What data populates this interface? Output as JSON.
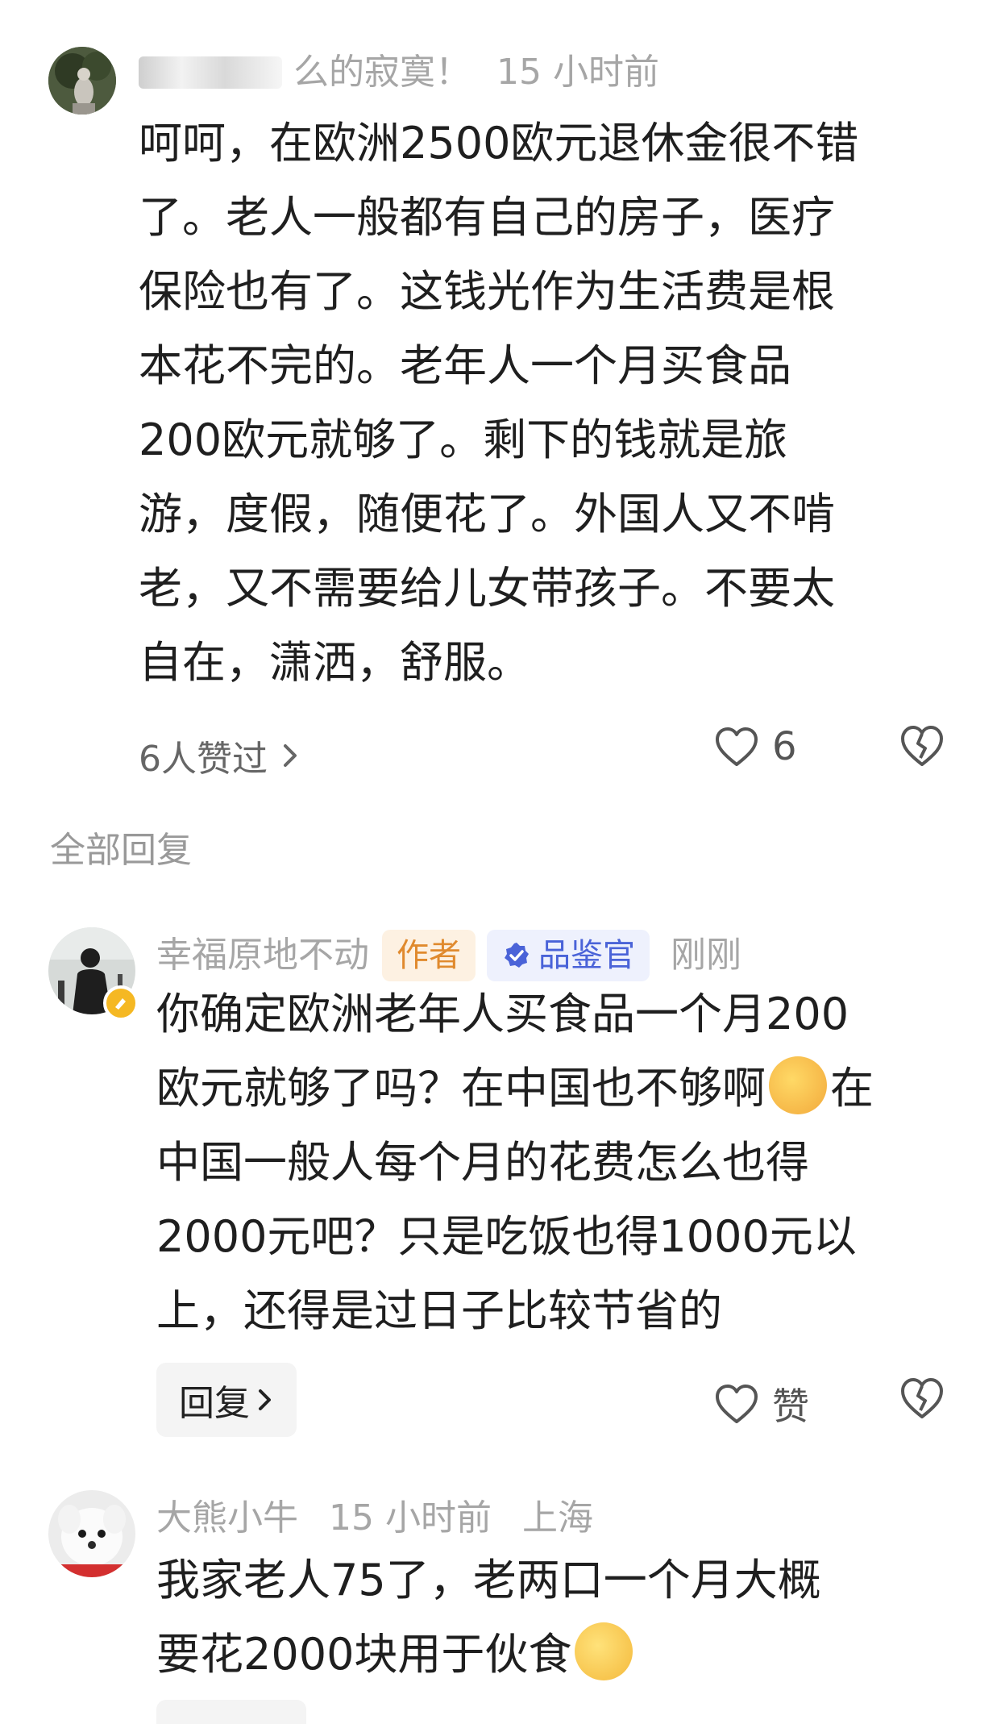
{
  "top_comment": {
    "username_partial": "么的寂寞！",
    "time": "15 小时前",
    "lines": [
      "呵呵，在欧洲2500欧元退休金很不错",
      "了。老人一般都有自己的房子，医疗",
      "保险也有了。这钱光作为生活费是根",
      "本花不完的。老年人一个月买食品",
      " 200欧元就够了。剩下的钱就是旅",
      "游，度假，随便花了。外国人又不啃",
      "老，又不需要给儿女带孩子。不要太",
      "自在，潇洒，舒服。"
    ],
    "liked_by": "6人赞过",
    "like_count": "6"
  },
  "section_label": "全部回复",
  "reply_1": {
    "username": "幸福原地不动",
    "author_tag": "作者",
    "badge_label": "品鉴官",
    "time": "刚刚",
    "lines": [
      "你确定欧洲老年人买食品一个月200",
      "欧元就够了吗？在中国也不够啊",
      "中国一般人每个月的花费怎么也得",
      " 2000元吧？只是吃饭也得1000元以",
      "上，还得是过日子比较节省的"
    ],
    "line2_tail": "在",
    "reply_button": "回复",
    "like_label": "赞"
  },
  "reply_2": {
    "username": "大熊小牛",
    "time": "15 小时前",
    "location": "上海",
    "lines": [
      "我家老人75了，老两口一个月大概",
      "要花2000块用于伙食"
    ]
  },
  "colors": {
    "meta_gray": "#a6a6a6",
    "author_tag_bg": "#fdf1e2",
    "author_tag_text": "#e08a2e",
    "badge_bg": "#eef1fd",
    "badge_text": "#4a63d8"
  }
}
